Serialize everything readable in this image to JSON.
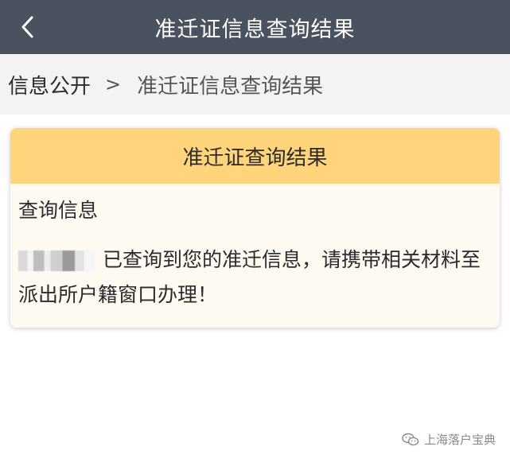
{
  "topbar": {
    "title": "准迁证信息查询结果",
    "back_icon": "chevron-left-icon",
    "background": "#4a5260"
  },
  "breadcrumb": {
    "home": "信息公开",
    "separator": ">",
    "current": "准迁证信息查询结果"
  },
  "card": {
    "header": "准迁证查询结果",
    "subtitle": "查询信息",
    "message": "已查询到您的准迁信息，请携带相关材料至派出所户籍窗口办理！",
    "header_color": "#ffd47a"
  },
  "watermark": {
    "text": "上海落户宝典",
    "icon": "wechat-icon"
  }
}
